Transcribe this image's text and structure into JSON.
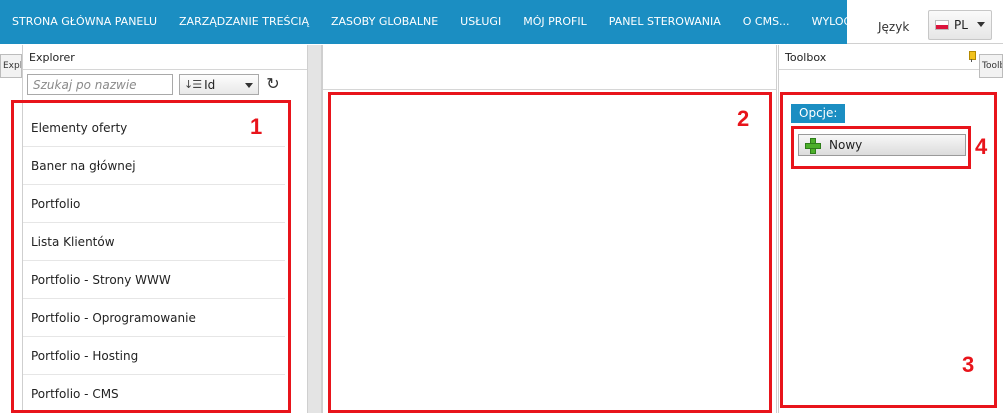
{
  "topnav": {
    "items": [
      "STRONA GŁÓWNA PANELU",
      "ZARZĄDZANIE TREŚCIĄ",
      "ZASOBY GLOBALNE",
      "USŁUGI",
      "MÓJ PROFIL",
      "PANEL STEROWANIA",
      "O CMS...",
      "WYLOGUJ..."
    ],
    "language_label": "Język",
    "language_value": "PL"
  },
  "left_tab": "Explo",
  "right_tab": "Toolb",
  "explorer": {
    "title": "Explorer",
    "search_placeholder": "Szukaj po nazwie",
    "sort_value": "Id",
    "items": [
      "Elementy oferty",
      "Baner na głównej",
      "Portfolio",
      "Lista Klientów",
      "Portfolio - Strony WWW",
      "Portfolio - Oprogramowanie",
      "Portfolio - Hosting",
      "Portfolio - CMS"
    ]
  },
  "toolbox": {
    "title": "Toolbox",
    "options_label": "Opcje:",
    "new_button_label": "Nowy"
  },
  "annotations": [
    "1",
    "2",
    "3",
    "4"
  ],
  "colors": {
    "nav_bg": "#1b8ec2",
    "annotation_red": "#e8141b"
  }
}
